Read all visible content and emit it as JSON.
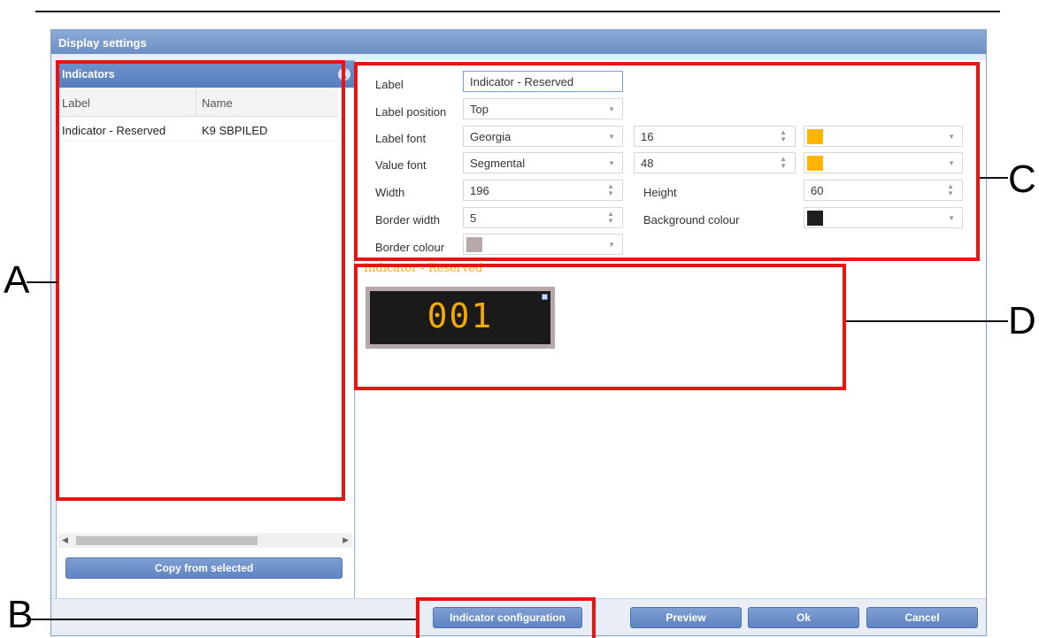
{
  "window": {
    "title": "Display settings"
  },
  "indicators_panel": {
    "title": "Indicators",
    "columns": [
      "Label",
      "Name"
    ],
    "rows": [
      {
        "label": "Indicator - Reserved",
        "name": "K9 SBPILED"
      }
    ],
    "copy_button": "Copy from selected"
  },
  "form": {
    "label": {
      "label": "Label",
      "value": "Indicator - Reserved"
    },
    "label_position": {
      "label": "Label position",
      "value": "Top"
    },
    "label_font": {
      "label": "Label font",
      "font": "Georgia",
      "size": "16",
      "color": "#ffb400"
    },
    "value_font": {
      "label": "Value font",
      "font": "Segmental",
      "size": "48",
      "color": "#ffb400"
    },
    "width": {
      "label": "Width",
      "value": "196"
    },
    "height": {
      "label": "Height",
      "value": "60"
    },
    "border_width": {
      "label": "Border width",
      "value": "5"
    },
    "background_colour": {
      "label": "Background colour",
      "color": "#1e1e1e"
    },
    "border_colour": {
      "label": "Border colour",
      "color": "#b9aaaa"
    }
  },
  "preview": {
    "label": "Indicator - Reserved",
    "value": "001"
  },
  "buttons": {
    "indicator_config": "Indicator configuration",
    "preview": "Preview",
    "ok": "Ok",
    "cancel": "Cancel"
  },
  "callouts": {
    "a": "A",
    "b": "B",
    "c": "C",
    "d": "D"
  }
}
